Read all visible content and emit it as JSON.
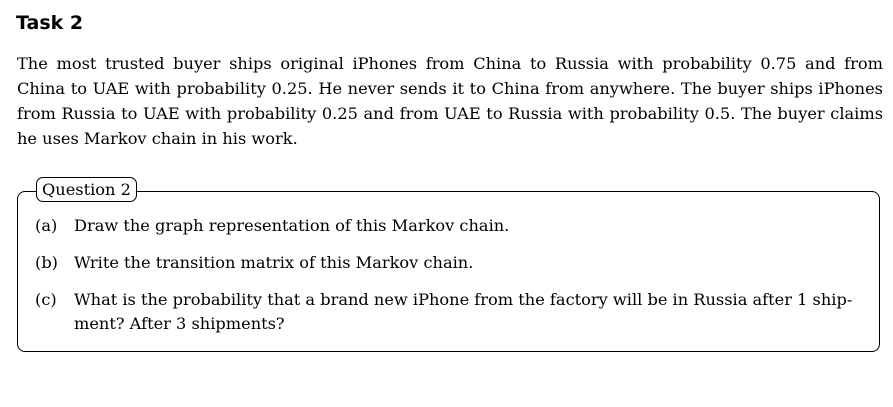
{
  "task": {
    "title": "Task 2",
    "text": "The most trusted buyer ships original iPhones from China to Russia with probability 0.75 and from China to UAE with probability 0.25. He never sends it to China from anywhere. The buyer ships iPhones from Russia to UAE with probability 0.25 and from UAE to Russia with probability 0.5. The buyer claims he uses Markov chain in his work."
  },
  "question": {
    "label": "Question 2",
    "items": [
      {
        "marker": "(a)",
        "text": "Draw the graph representation of this Markov chain."
      },
      {
        "marker": "(b)",
        "text": "Write the transition matrix of this Markov chain."
      },
      {
        "marker": "(c)",
        "text": "What is the probability that a brand new iPhone from the factory will be in Russia after 1 ship­ment? After 3 shipments?"
      }
    ]
  }
}
